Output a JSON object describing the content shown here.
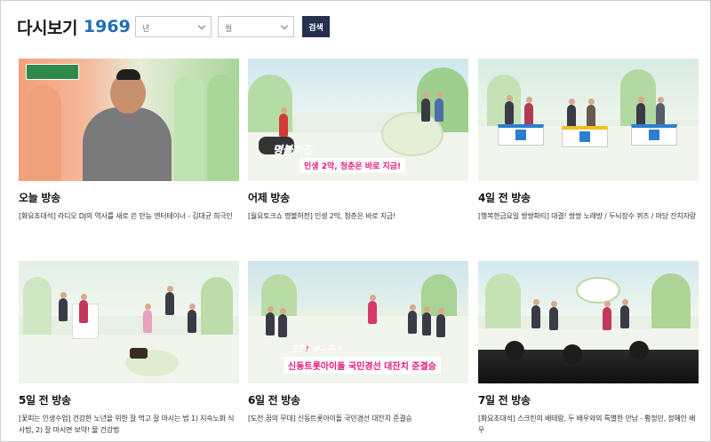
{
  "header": {
    "title": "다시보기",
    "count": "1969",
    "year_placeholder": "년",
    "month_placeholder": "월",
    "search_label": "검색"
  },
  "episodes": [
    {
      "when": "오늘 방송",
      "desc": "[화요초대석] 라디오 DJ의 역사를 새로 쓴 만능 엔터테이너 - 김대균 희극인"
    },
    {
      "when": "어제 방송",
      "desc": "[월요토크쇼 명불허전] 인생 2막, 청춘은 바로 지금!",
      "thumb_caption_1": "명불허전",
      "thumb_caption_2": "인생 2막, 청춘은 바로 지금!"
    },
    {
      "when": "4일 전 방송",
      "desc": "[행복한금요일 쌍쌍파티] 대결! 쌍쌍 노래방 / 두뇌장수 퀴즈 / 마당 잔치자랑"
    },
    {
      "when": "5일 전 방송",
      "desc": "[꽃피는 인생수업] 건강한 노년을 위한 잘 먹고 잘 마시는 법 1) 지속노화 식사법, 2) 잘 마시면 보약! 물 건강법"
    },
    {
      "when": "6일 전 방송",
      "desc": "[도전 꿈의 무대] 신동트롯아이돌 국민경선 대잔치 준결승",
      "thumb_caption_1": "도전! 꿈의무대",
      "thumb_caption_2": "신동트롯아이돌 국민경선 대잔치 준결승"
    },
    {
      "when": "7일 전 방송",
      "desc": "[화요초대석] 스크린의 배테랑, 두 배우와의 특별한 만남 - 황정민, 정혜인 배우"
    }
  ],
  "colors": {
    "accent": "#1f6fb2",
    "search_button": "#26314f"
  }
}
